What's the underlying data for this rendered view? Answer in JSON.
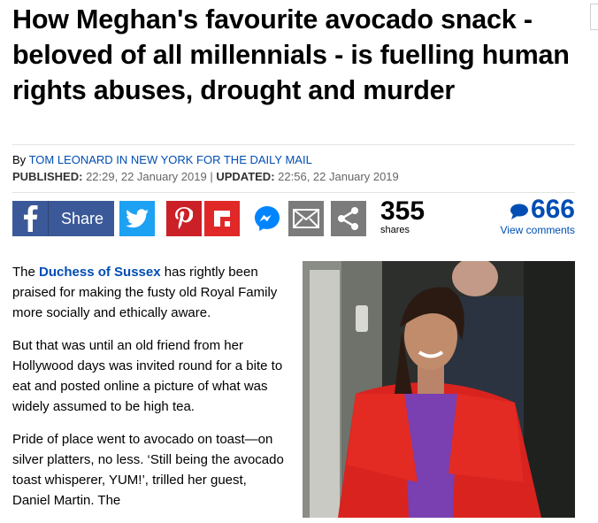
{
  "article": {
    "headline": "How Meghan's favourite avocado snack - beloved of all millennials - is fuelling human rights abuses, drought and murder",
    "byline_prefix": "By",
    "author": "Tom Leonard in New York for the Daily Mail",
    "published_label": "PUBLISHED:",
    "published_value": "22:29, 22 January 2019",
    "separator": "|",
    "updated_label": "UPDATED:",
    "updated_value": "22:56, 22 January 2019"
  },
  "share": {
    "facebook_label": "Share",
    "icons": [
      "facebook-icon",
      "twitter-icon",
      "pinterest-icon",
      "flipboard-icon",
      "messenger-icon",
      "email-icon",
      "share-icon"
    ],
    "count": "355",
    "count_label": "shares",
    "comments_count": "666",
    "comments_link": "View comments",
    "colors": {
      "facebook": "#3b5998",
      "twitter": "#1da1f2",
      "pinterest": "#cb2027",
      "flipboard": "#e12828",
      "messenger": "#0084ff",
      "grey": "#7b7b7b",
      "link": "#004db3"
    }
  },
  "body": {
    "p1_prefix": "The",
    "p1_link": "Duchess of Sussex",
    "p1_rest": "has rightly been praised for making the fusty old Royal Family more socially and ethically aware.",
    "p2": "But that was until an old friend from her Hollywood days was invited round for a bite to eat and posted online a picture of what was widely assumed to be high tea.",
    "p3": "Pride of place went to avocado on toast—on silver platters, no less. ‘Still being the avocado toast whisperer, YUM!’, trilled her guest, Daniel Martin. The"
  }
}
